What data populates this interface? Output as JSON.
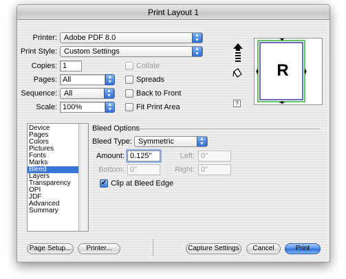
{
  "window": {
    "title": "Print Layout 1"
  },
  "form": {
    "printer_label": "Printer:",
    "printer_value": "Adobe PDF 8.0",
    "print_style_label": "Print Style:",
    "print_style_value": "Custom Settings",
    "copies_label": "Copies:",
    "copies_value": "1",
    "pages_label": "Pages:",
    "pages_value": "All",
    "sequence_label": "Sequence:",
    "sequence_value": "All",
    "scale_label": "Scale:",
    "scale_value": "100%"
  },
  "checkboxes": {
    "collate": {
      "label": "Collate",
      "checked": false,
      "enabled": false
    },
    "spreads": {
      "label": "Spreads",
      "checked": false,
      "enabled": true
    },
    "back_to_front": {
      "label": "Back to Front",
      "checked": false,
      "enabled": true
    },
    "fit_print_area": {
      "label": "Fit Print Area",
      "checked": false,
      "enabled": true
    }
  },
  "preview": {
    "letter": "R",
    "help_label": "?"
  },
  "sidebar": {
    "items": [
      {
        "label": "Device"
      },
      {
        "label": "Pages"
      },
      {
        "label": "Colors"
      },
      {
        "label": "Pictures"
      },
      {
        "label": "Fonts"
      },
      {
        "label": "Marks"
      },
      {
        "label": "Bleed",
        "selected": true
      },
      {
        "label": "Layers"
      },
      {
        "label": "Transparency"
      },
      {
        "label": "OPI"
      },
      {
        "label": "JDF"
      },
      {
        "label": "Advanced"
      },
      {
        "label": "Summary"
      }
    ]
  },
  "bleed": {
    "group_title": "Bleed Options",
    "bleed_type_label": "Bleed Type:",
    "bleed_type_value": "Symmetric",
    "amount_label": "Amount:",
    "amount_value": "0.125\"",
    "left_label": "Left:",
    "left_value": "0\"",
    "bottom_label": "Bottom:",
    "bottom_value": "0\"",
    "right_label": "Right:",
    "right_value": "0\"",
    "clip_label": "Clip at Bleed Edge",
    "clip_checked": true
  },
  "buttons": {
    "page_setup": "Page Setup...",
    "printer": "Printer...",
    "capture_settings": "Capture Settings",
    "cancel": "Cancel",
    "print": "Print"
  },
  "colors": {
    "accent": "#3875d7",
    "page_outline": "#3a3aa8",
    "bleed_outline": "#2bb52b"
  }
}
